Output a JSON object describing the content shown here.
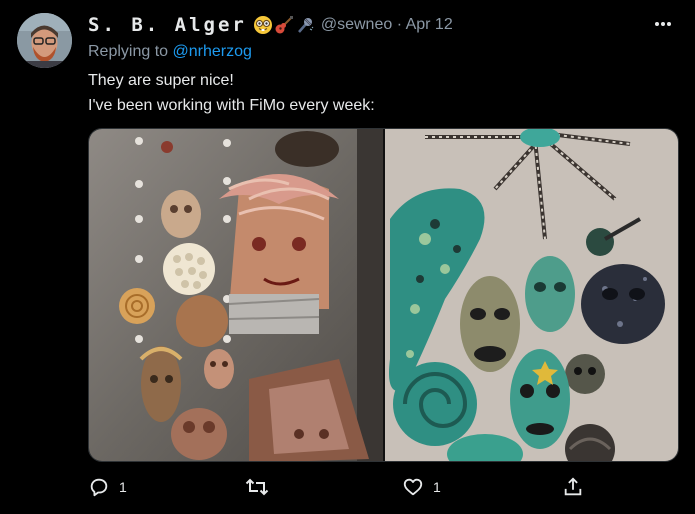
{
  "author": {
    "display_name": "S. B. Alger",
    "emojis": [
      "nerd-face-emoji",
      "guitar-emoji",
      "microphone-emoji"
    ],
    "handle": "@sewneo",
    "separator": "·",
    "date": "Apr 12"
  },
  "reply": {
    "prefix": "Replying to",
    "mention": "@nrherzog"
  },
  "text": {
    "line1": "They are super nice!",
    "line2": "I've been working with FiMo every week:"
  },
  "actions": {
    "reply_count": "1",
    "retweet_count": "",
    "like_count": "1"
  },
  "icons": {
    "more": "more-horizontal-icon",
    "reply": "reply-icon",
    "retweet": "retweet-icon",
    "like": "heart-icon",
    "share": "share-icon"
  },
  "colors": {
    "background": "#000000",
    "text": "#e7e9ea",
    "secondary": "#8b98a5",
    "link": "#1d9bf0"
  }
}
